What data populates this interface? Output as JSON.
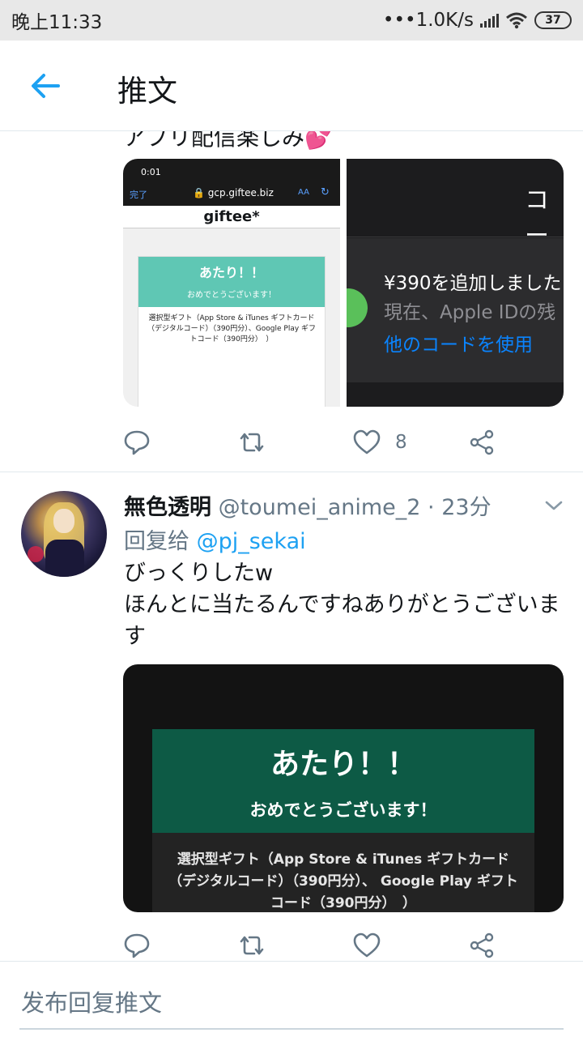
{
  "status_bar": {
    "time": "晚上11:33",
    "network_speed": "•••1.0K/s",
    "battery": "37"
  },
  "header": {
    "back_icon": "arrow-left-icon",
    "title": "推文"
  },
  "tweet1": {
    "text_cut": "アプリ配信楽しみ",
    "emoji": "💕",
    "media": {
      "left": {
        "time": "0:01",
        "done": "完了",
        "url": "gcp.giftee.biz",
        "aa": "AA",
        "site": "giftee*",
        "win": "あたり！！",
        "congrats": "おめでとうございます！",
        "desc": "選択型ギフト（App Store & iTunes ギフトカード（デジタルコード）（390円分）、Google Play ギフトコード（390円分）　）"
      },
      "right": {
        "title": "コー",
        "added": "¥390を追加しました",
        "current": "現在、Apple IDの残",
        "other": "他のコードを使用"
      }
    },
    "actions": {
      "reply_icon": "reply-icon",
      "retweet_icon": "retweet-icon",
      "like_icon": "heart-icon",
      "like_count": "8",
      "share_icon": "share-icon"
    }
  },
  "tweet2": {
    "name": "無色透明",
    "handle": "@toumei_anime_2 · 23分",
    "reply_prefix": "回复给 ",
    "reply_to": "@pj_sekai",
    "text_line1": "びっくりしたw",
    "text_line2": "ほんとに当たるんですねありがとうございます",
    "media": {
      "win": "あたり！！",
      "congrats": "おめでとうございます！",
      "desc": "選択型ギフト（App Store & iTunes ギフトカード（デジタルコード）（390円分）、 Google Play ギフトコード（390円分）　）"
    },
    "actions": {
      "reply_icon": "reply-icon",
      "retweet_icon": "retweet-icon",
      "like_icon": "heart-icon",
      "share_icon": "share-icon"
    }
  },
  "reply_bar": {
    "placeholder": "发布回复推文"
  },
  "colors": {
    "accent": "#1da1f2",
    "secondary_text": "#657786",
    "divider": "#e1e8ed"
  }
}
